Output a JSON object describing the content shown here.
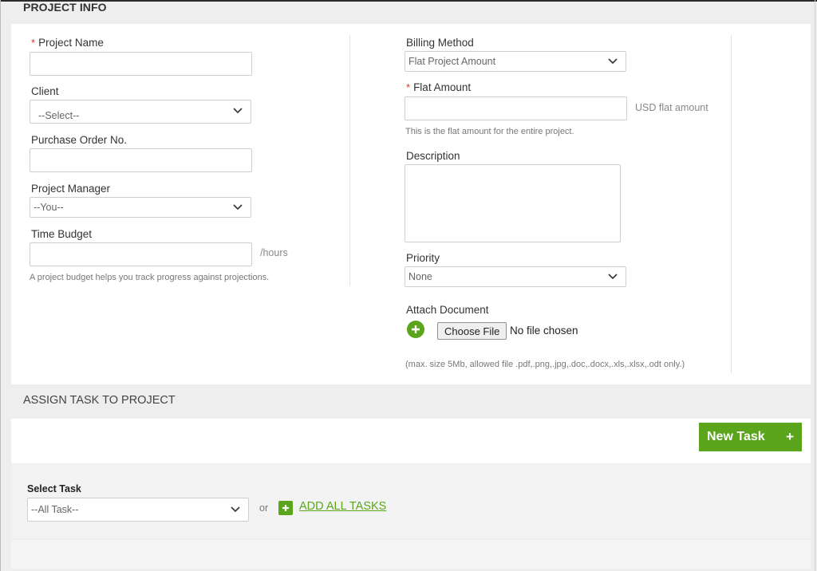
{
  "project_info": {
    "title": "PROJECT INFO",
    "project_name": {
      "label": "Project Name",
      "required": "*",
      "value": ""
    },
    "client": {
      "label": "Client",
      "selected": "--Select--"
    },
    "purchase_order": {
      "label": "Purchase Order No.",
      "value": ""
    },
    "project_manager": {
      "label": "Project Manager",
      "selected": "--You--"
    },
    "time_budget": {
      "label": "Time Budget",
      "value": "",
      "suffix": "/hours",
      "hint": "A project budget helps you track progress against projections."
    },
    "billing_method": {
      "label": "Billing Method",
      "selected": "Flat Project Amount"
    },
    "flat_amount": {
      "label": "Flat Amount",
      "required": "*",
      "value": "",
      "suffix": "USD flat amount",
      "hint": "This is the flat amount for the entire project."
    },
    "description": {
      "label": "Description",
      "value": ""
    },
    "priority": {
      "label": "Priority",
      "selected": "None"
    },
    "attach_document": {
      "label": "Attach Document",
      "button": "Choose File",
      "status": "No file chosen",
      "hint": "(max. size 5Mb, allowed file .pdf,.png,.jpg,.doc,.docx,.xls,.xlsx,.odt only.)"
    }
  },
  "assign_task": {
    "title": "ASSIGN TASK TO PROJECT",
    "new_task_label": "New Task",
    "new_task_plus": "+",
    "select_task": {
      "label": "Select Task",
      "selected": "--All Task--"
    },
    "or_text": "or",
    "add_all_label": "ADD ALL TASKS"
  },
  "colors": {
    "accent_green": "#5aa51c",
    "required_red": "#d9342b"
  },
  "icons": {
    "dropdown": "chevron-down-icon",
    "attach": "plus-circle-icon",
    "add_all": "plus-square-icon"
  }
}
